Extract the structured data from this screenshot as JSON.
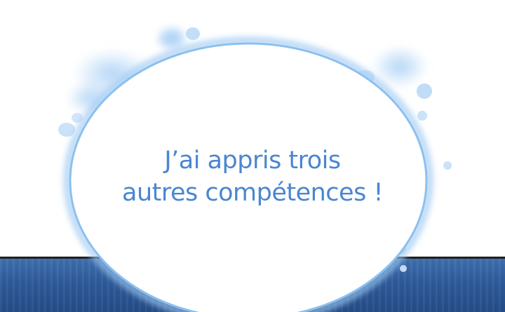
{
  "panel": {
    "speech": {
      "line1": "J’ai appris trois",
      "line2": "autres compétences !"
    },
    "colors": {
      "text": "#4a86d2",
      "bubble_glow": "#9ec9f2",
      "bubble_fill": "#ffffff",
      "bottom_band": "#2e5a9a",
      "background": "#ffffff"
    }
  }
}
